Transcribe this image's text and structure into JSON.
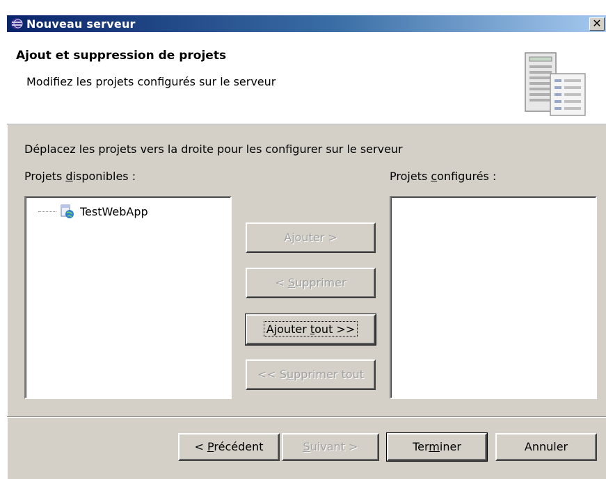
{
  "window": {
    "title": "Nouveau serveur",
    "close_label": "✕"
  },
  "header": {
    "title": "Ajout et suppression de projets",
    "description": "Modifiez les projets configurés sur le serveur"
  },
  "instructions": "Déplacez les projets vers la droite pour les configurer sur le serveur",
  "available": {
    "label_pre": "Projets ",
    "label_mnemonic": "d",
    "label_post": "isponibles :",
    "items": [
      "TestWebApp"
    ]
  },
  "configured": {
    "label_pre": "Projets ",
    "label_mnemonic": "c",
    "label_post": "onfigurés :",
    "items": []
  },
  "move_buttons": {
    "add_pre": "A",
    "add_mnemonic": "j",
    "add_post": "outer >",
    "remove_pre": "< ",
    "remove_mnemonic": "S",
    "remove_post": "upprimer",
    "add_all_pre": "Ajouter ",
    "add_all_mnemonic": "t",
    "add_all_post": "out >>",
    "remove_all_pre": "<< S",
    "remove_all_mnemonic": "u",
    "remove_all_post": "pprimer tout"
  },
  "footer": {
    "back_pre": "< ",
    "back_mnemonic": "P",
    "back_post": "récédent",
    "next_pre": "",
    "next_mnemonic": "S",
    "next_post": "uivant >",
    "finish_pre": "Ter",
    "finish_mnemonic": "m",
    "finish_post": "iner",
    "cancel": "Annuler"
  },
  "colors": {
    "title_bar_start": "#0a246a",
    "title_bar_end": "#a6caf0",
    "dialog_bg": "#d4d0c8",
    "disabled_text": "#a0a0a0"
  },
  "icons": {
    "app": "eclipse-icon",
    "header": "server-icon",
    "project": "web-project-icon"
  }
}
